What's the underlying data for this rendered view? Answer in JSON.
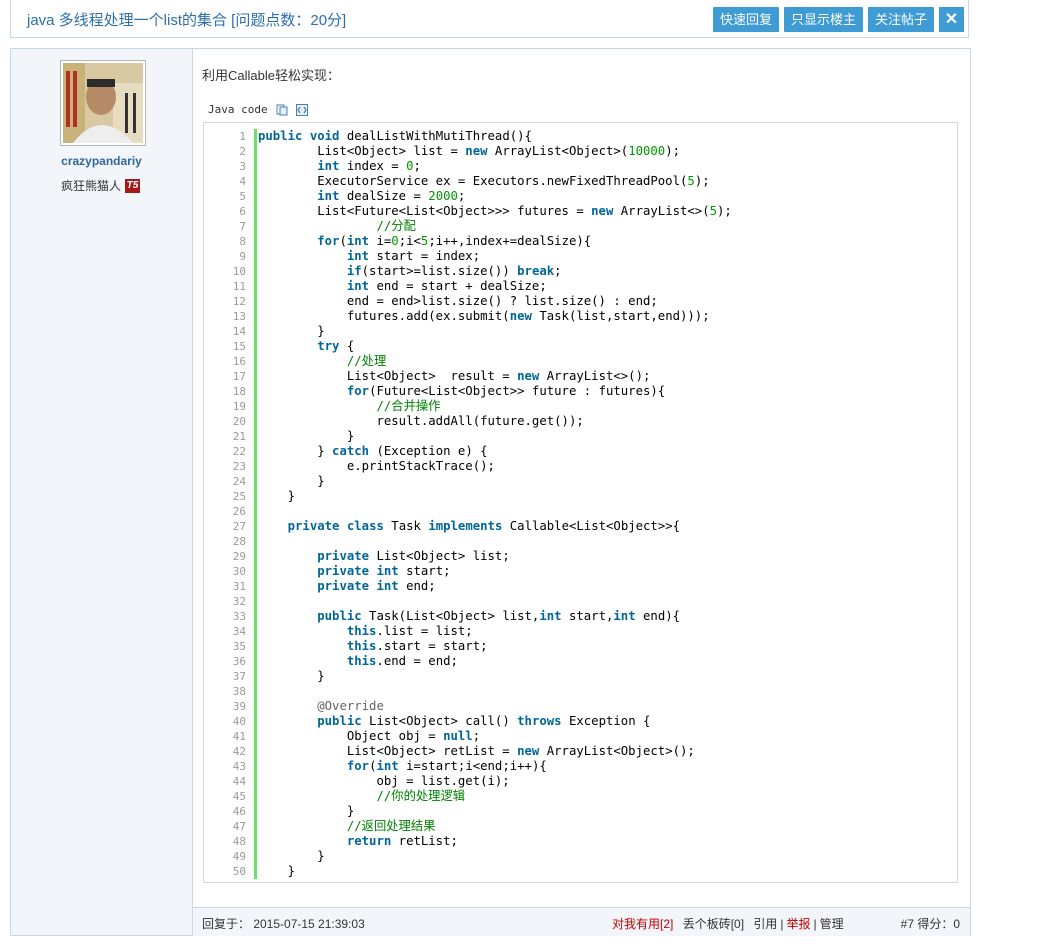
{
  "topbar": {
    "title": "java 多线程处理一个list的集合 [问题点数：20分]",
    "buttons": [
      "快速回复",
      "只显示楼主",
      "关注帖子"
    ],
    "close_icon": "✕"
  },
  "user": {
    "username": "crazypandariy",
    "nickname": "疯狂熊猫人",
    "badge": "T5"
  },
  "post": {
    "intro": "利用Callable轻松实现：",
    "code_lang": "Java code"
  },
  "code_lines": [
    "public void dealListWithMutiThread(){",
    "        List<Object> list = new ArrayList<Object>(10000);",
    "        int index = 0;",
    "        ExecutorService ex = Executors.newFixedThreadPool(5);",
    "        int dealSize = 2000;",
    "        List<Future<List<Object>>> futures = new ArrayList<>(5);",
    "                //分配",
    "        for(int i=0;i<5;i++,index+=dealSize){",
    "            int start = index;",
    "            if(start>=list.size()) break;",
    "            int end = start + dealSize;",
    "            end = end>list.size() ? list.size() : end;",
    "            futures.add(ex.submit(new Task(list,start,end)));",
    "        }",
    "        try {",
    "            //处理",
    "            List<Object>  result = new ArrayList<>();",
    "            for(Future<List<Object>> future : futures){",
    "                //合并操作",
    "                result.addAll(future.get());",
    "            }",
    "        } catch (Exception e) {",
    "            e.printStackTrace();",
    "        }",
    "    }",
    "",
    "    private class Task implements Callable<List<Object>>{",
    "",
    "        private List<Object> list;",
    "        private int start;",
    "        private int end;",
    "",
    "        public Task(List<Object> list,int start,int end){",
    "            this.list = list;",
    "            this.start = start;",
    "            this.end = end;",
    "        }",
    "",
    "        @Override",
    "        public List<Object> call() throws Exception {",
    "            Object obj = null;",
    "            List<Object> retList = new ArrayList<Object>();",
    "            for(int i=start;i<end;i++){",
    "                obj = list.get(i);",
    "                //你的处理逻辑",
    "            }",
    "            //返回处理结果",
    "            return retList;",
    "        }",
    "    }"
  ],
  "footer": {
    "reply_time": "回复于： 2015-07-15 21:39:03",
    "useful": "对我有用[2]",
    "brick": "丢个板砖[0]",
    "quote": "引用",
    "report": "举报",
    "manage": "管理",
    "floor": "#7 得分：0"
  }
}
